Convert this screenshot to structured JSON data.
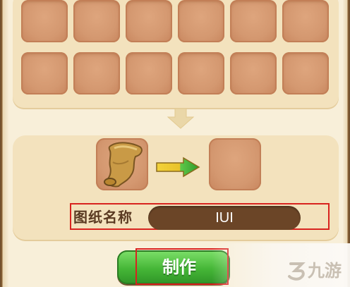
{
  "crafting": {
    "grid_slots_per_row": 6,
    "grid_rows": 2,
    "name_label": "图纸名称",
    "name_value": "IUI",
    "make_button_label": "制作",
    "material_icon": "blueprint-scroll-icon",
    "transform_icon": "arrow-right-icon",
    "flow_icon": "arrow-down-icon"
  },
  "watermark": {
    "text": "九游",
    "logo_icon": "jiuyou-logo-icon"
  },
  "colors": {
    "panel_bg": "#f3e2bd",
    "slot": "#d49870",
    "name_field_bg": "#6b4527",
    "button_green": "#45b637",
    "highlight_red": "#d8231f"
  }
}
